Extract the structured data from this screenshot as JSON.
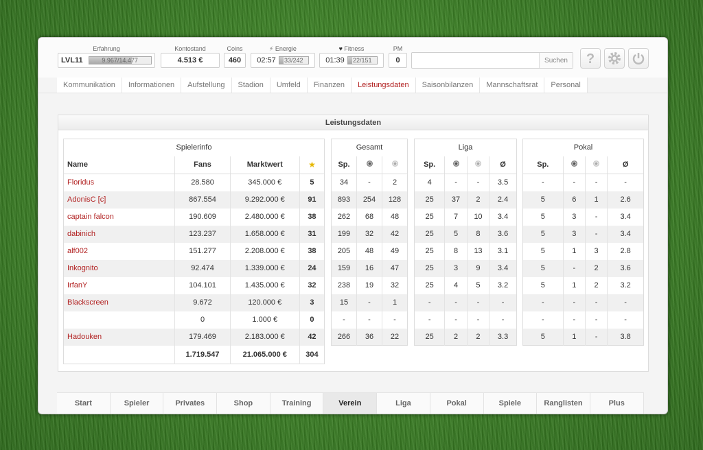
{
  "topbar": {
    "erfahrung": {
      "label": "Erfahrung",
      "level": "LVL11",
      "value": "9.967/14.477",
      "progress": 0.69
    },
    "kontostand": {
      "label": "Kontostand",
      "value": "4.513 €"
    },
    "coins": {
      "label": "Coins",
      "value": "460"
    },
    "energie": {
      "label": "Energie",
      "time": "02:57",
      "value": "33/242",
      "progress": 0.14
    },
    "fitness": {
      "label": "Fitness",
      "time": "01:39",
      "value": "22/151",
      "progress": 0.15
    },
    "pm": {
      "label": "PM",
      "value": "0"
    },
    "search": {
      "placeholder": "",
      "button": "Suchen"
    },
    "icons": {
      "help": "question-icon",
      "settings": "gear-icon",
      "logout": "power-icon"
    }
  },
  "tabs": [
    {
      "label": "Kommunikation",
      "active": false
    },
    {
      "label": "Informationen",
      "active": false
    },
    {
      "label": "Aufstellung",
      "active": false
    },
    {
      "label": "Stadion",
      "active": false
    },
    {
      "label": "Umfeld",
      "active": false
    },
    {
      "label": "Finanzen",
      "active": false
    },
    {
      "label": "Leistungsdaten",
      "active": true
    },
    {
      "label": "Saisonbilanzen",
      "active": false
    },
    {
      "label": "Mannschaftsrat",
      "active": false
    },
    {
      "label": "Personal",
      "active": false
    }
  ],
  "panel": {
    "title": "Leistungsdaten"
  },
  "spielerinfo": {
    "group": "Spielerinfo",
    "headers": {
      "name": "Name",
      "fans": "Fans",
      "marktwert": "Marktwert"
    },
    "rows": [
      {
        "name": "Floridus",
        "fans": "28.580",
        "marktwert": "345.000 €",
        "stars": "5"
      },
      {
        "name": "AdonisC [c]",
        "fans": "867.554",
        "marktwert": "9.292.000 €",
        "stars": "91"
      },
      {
        "name": "captain falcon",
        "fans": "190.609",
        "marktwert": "2.480.000 €",
        "stars": "38"
      },
      {
        "name": "dabinich",
        "fans": "123.237",
        "marktwert": "1.658.000 €",
        "stars": "31"
      },
      {
        "name": "alf002",
        "fans": "151.277",
        "marktwert": "2.208.000 €",
        "stars": "38"
      },
      {
        "name": "Inkognito",
        "fans": "92.474",
        "marktwert": "1.339.000 €",
        "stars": "24"
      },
      {
        "name": "IrfanY",
        "fans": "104.101",
        "marktwert": "1.435.000 €",
        "stars": "32"
      },
      {
        "name": "Blackscreen",
        "fans": "9.672",
        "marktwert": "120.000 €",
        "stars": "3"
      },
      {
        "name": "",
        "fans": "0",
        "marktwert": "1.000 €",
        "stars": "0"
      },
      {
        "name": "Hadouken",
        "fans": "179.469",
        "marktwert": "2.183.000 €",
        "stars": "42"
      }
    ],
    "totals": {
      "fans": "1.719.547",
      "marktwert": "21.065.000 €",
      "stars": "304"
    }
  },
  "gesamt": {
    "group": "Gesamt",
    "sp": "Sp.",
    "rows": [
      [
        "34",
        "-",
        "2"
      ],
      [
        "893",
        "254",
        "128"
      ],
      [
        "262",
        "68",
        "48"
      ],
      [
        "199",
        "32",
        "42"
      ],
      [
        "205",
        "48",
        "49"
      ],
      [
        "159",
        "16",
        "47"
      ],
      [
        "238",
        "19",
        "32"
      ],
      [
        "15",
        "-",
        "1"
      ],
      [
        "-",
        "-",
        "-"
      ],
      [
        "266",
        "36",
        "22"
      ]
    ]
  },
  "liga": {
    "group": "Liga",
    "sp": "Sp.",
    "avg": "Ø",
    "rows": [
      [
        "4",
        "-",
        "-",
        "3.5"
      ],
      [
        "25",
        "37",
        "2",
        "2.4"
      ],
      [
        "25",
        "7",
        "10",
        "3.4"
      ],
      [
        "25",
        "5",
        "8",
        "3.6"
      ],
      [
        "25",
        "8",
        "13",
        "3.1"
      ],
      [
        "25",
        "3",
        "9",
        "3.4"
      ],
      [
        "25",
        "4",
        "5",
        "3.2"
      ],
      [
        "-",
        "-",
        "-",
        "-"
      ],
      [
        "-",
        "-",
        "-",
        "-"
      ],
      [
        "25",
        "2",
        "2",
        "3.3"
      ]
    ]
  },
  "pokal": {
    "group": "Pokal",
    "sp": "Sp.",
    "avg": "Ø",
    "rows": [
      [
        "-",
        "-",
        "-",
        "-"
      ],
      [
        "5",
        "6",
        "1",
        "2.6"
      ],
      [
        "5",
        "3",
        "-",
        "3.4"
      ],
      [
        "5",
        "3",
        "-",
        "3.4"
      ],
      [
        "5",
        "1",
        "3",
        "2.8"
      ],
      [
        "5",
        "-",
        "2",
        "3.6"
      ],
      [
        "5",
        "1",
        "2",
        "3.2"
      ],
      [
        "-",
        "-",
        "-",
        "-"
      ],
      [
        "-",
        "-",
        "-",
        "-"
      ],
      [
        "5",
        "1",
        "-",
        "3.8"
      ]
    ]
  },
  "bottom_nav": [
    {
      "label": "Start",
      "active": false
    },
    {
      "label": "Spieler",
      "active": false
    },
    {
      "label": "Privates",
      "active": false
    },
    {
      "label": "Shop",
      "active": false
    },
    {
      "label": "Training",
      "active": false
    },
    {
      "label": "Verein",
      "active": true
    },
    {
      "label": "Liga",
      "active": false
    },
    {
      "label": "Pokal",
      "active": false
    },
    {
      "label": "Spiele",
      "active": false
    },
    {
      "label": "Ranglisten",
      "active": false
    },
    {
      "label": "Plus",
      "active": false
    }
  ],
  "colors": {
    "accent": "#b22222",
    "grass": "#3c7f26"
  }
}
